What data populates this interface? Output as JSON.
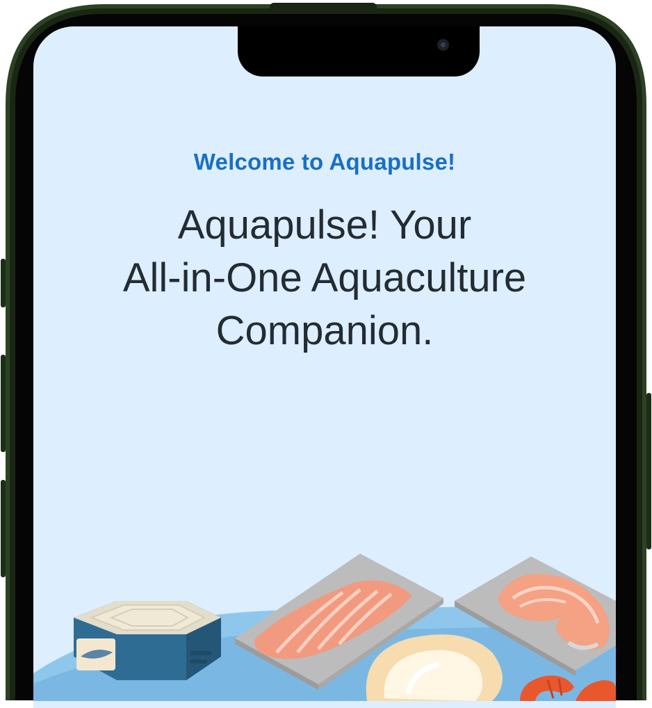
{
  "onboarding": {
    "subtitle": "Welcome to Aquapulse!",
    "headline_line1": "Aquapulse! Your",
    "headline_line2": "All-in-One Aquaculture",
    "headline_line3": "Companion."
  },
  "colors": {
    "screen_background": "#ddeeff",
    "subtitle_accent": "#1a6fc4",
    "headline_text": "#232b33",
    "device_frame": "#2c4223"
  },
  "illustration": {
    "items": [
      "tin-can-icon",
      "salmon-fillet-icon",
      "salmon-steak-icon",
      "oyster-icon",
      "shrimp-icon"
    ]
  }
}
